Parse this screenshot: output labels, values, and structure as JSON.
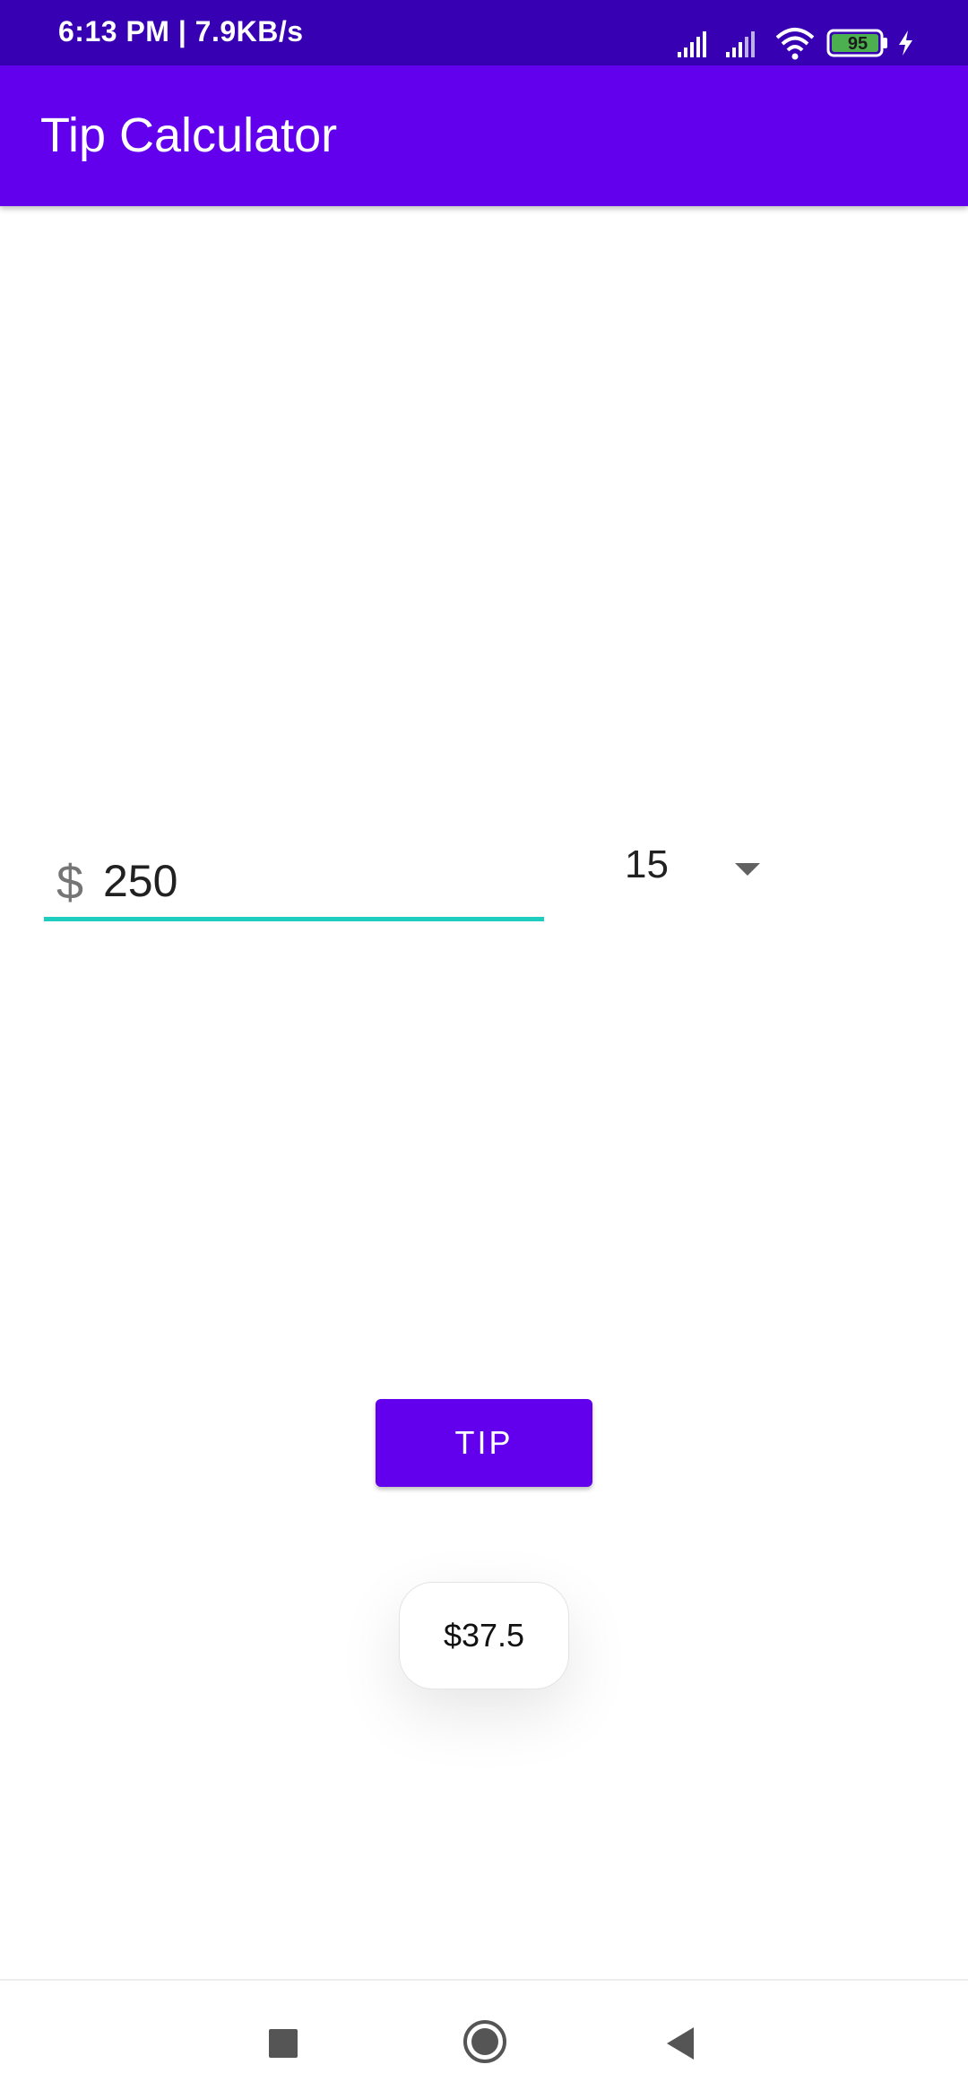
{
  "status_bar": {
    "time_network": "6:13 PM | 7.9KB/s",
    "battery_level": "95",
    "color": "#3700b3"
  },
  "app_bar": {
    "title": "Tip Calculator",
    "color": "#6200ee"
  },
  "bill_input": {
    "currency_prefix": "$",
    "value": "250",
    "underline_color": "#1fcdbf"
  },
  "tip_spinner": {
    "selected_value": "15"
  },
  "tip_button": {
    "label": "TIP"
  },
  "toast": {
    "message": "$37.5"
  },
  "nav_bar": {
    "icons": [
      "recents-icon",
      "home-icon",
      "back-icon"
    ]
  }
}
